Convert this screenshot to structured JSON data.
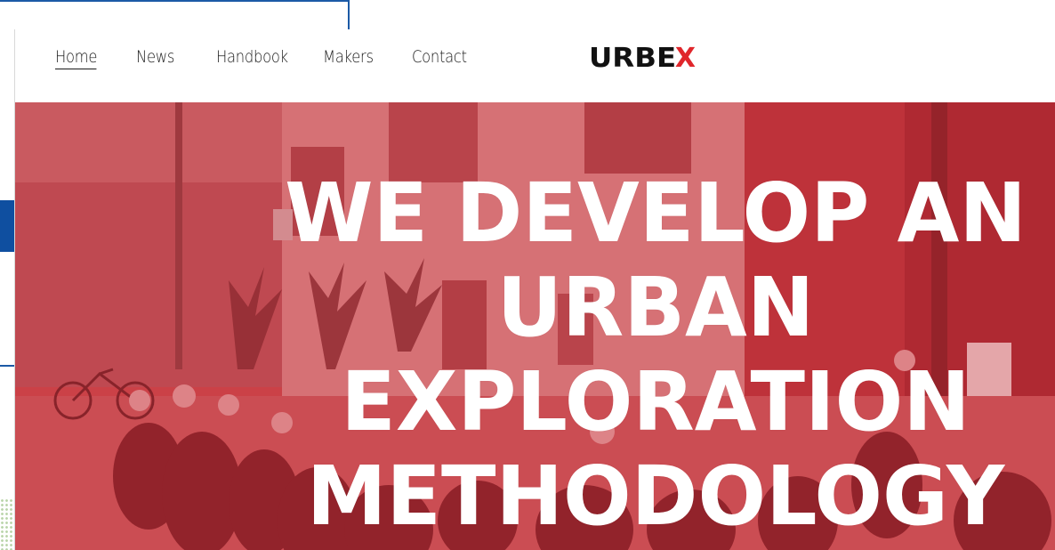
{
  "nav": {
    "items": [
      {
        "label": "Home",
        "active": true
      },
      {
        "label": "News",
        "active": false
      },
      {
        "label": "Handbook",
        "active": false
      },
      {
        "label": "Makers",
        "active": false
      },
      {
        "label": "Contact",
        "active": false
      }
    ]
  },
  "logo": {
    "main": "URBE",
    "accent": "X"
  },
  "hero": {
    "lines": [
      "WE DEVELOP AN",
      "URBAN",
      "EXPLORATION",
      "METHODOLOGY"
    ],
    "overlay_color": "#d2333b"
  },
  "colors": {
    "brand_red": "#e0262b",
    "frame_blue": "#1c5aa6"
  }
}
